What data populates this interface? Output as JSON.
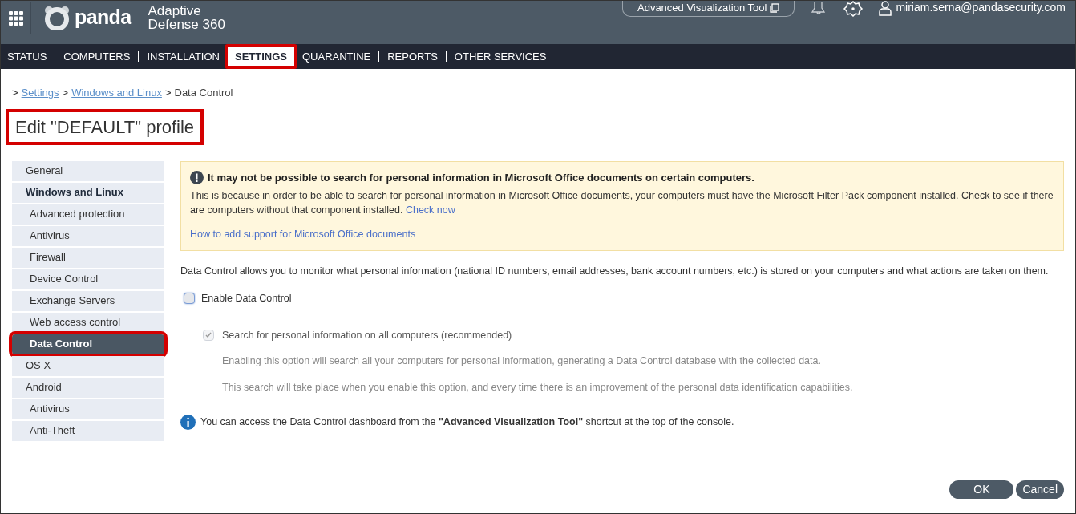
{
  "header": {
    "logo": "panda",
    "product": [
      "Adaptive",
      "Defense 360"
    ],
    "tool_button": "Advanced Visualization Tool",
    "user": "miriam.serna@pandasecurity.com"
  },
  "nav": [
    {
      "label": "STATUS",
      "selected": false,
      "highlighted": false
    },
    {
      "label": "COMPUTERS",
      "selected": false,
      "highlighted": false
    },
    {
      "label": "INSTALLATION",
      "selected": false,
      "highlighted": false
    },
    {
      "label": "SETTINGS",
      "selected": true,
      "highlighted": true
    },
    {
      "label": "QUARANTINE",
      "selected": false,
      "highlighted": false
    },
    {
      "label": "REPORTS",
      "selected": false,
      "highlighted": false
    },
    {
      "label": "OTHER SERVICES",
      "selected": false,
      "highlighted": false
    }
  ],
  "breadcrumb": [
    {
      "separator": ">",
      "label": "Settings",
      "link": true
    },
    {
      "separator": ">",
      "label": "Windows and Linux",
      "link": true
    },
    {
      "separator": ">",
      "label": "Data Control",
      "link": false
    }
  ],
  "page_title": {
    "text": "Edit \"DEFAULT\" profile",
    "highlighted": true
  },
  "sidebar": [
    {
      "label": "General",
      "selected": false,
      "highlighted": false
    },
    {
      "label": "Windows and Linux",
      "selected": true,
      "highlighted": false,
      "children": [
        {
          "label": "Advanced protection",
          "selected": false,
          "highlighted": false
        },
        {
          "label": "Antivirus",
          "selected": false,
          "highlighted": false
        },
        {
          "label": "Firewall",
          "selected": false,
          "highlighted": false
        },
        {
          "label": "Device Control",
          "selected": false,
          "highlighted": false
        },
        {
          "label": "Exchange Servers",
          "selected": false,
          "highlighted": false
        },
        {
          "label": "Web access control",
          "selected": false,
          "highlighted": false
        },
        {
          "label": "Data Control",
          "selected": true,
          "highlighted": true
        }
      ]
    },
    {
      "label": "OS X",
      "selected": false,
      "highlighted": false
    },
    {
      "label": "Android",
      "selected": false,
      "highlighted": false,
      "children": [
        {
          "label": "Antivirus",
          "selected": false,
          "highlighted": false
        },
        {
          "label": "Anti-Theft",
          "selected": false,
          "highlighted": false
        }
      ]
    }
  ],
  "warning": {
    "title": "It may not be possible to search for personal information in Microsoft Office documents on certain computers.",
    "text": "This is because in order to be able to search for personal information in Microsoft Office documents, your computers must have the Microsoft Filter Pack component installed. Check to see if there are computers without that component installed.",
    "check_link": "Check now",
    "support_link": "How to add support for Microsoft Office documents"
  },
  "description": "Data Control allows you to monitor what personal information (national ID numbers, email addresses, bank account numbers, etc.) is stored on your computers and what actions are taken on them.",
  "enable_option": {
    "label": "Enable Data Control",
    "checked": false,
    "disabled": false
  },
  "search_option": {
    "label": "Search for personal information on all computers (recommended)",
    "checked": true,
    "disabled": true,
    "notes": [
      "Enabling this option will search all your computers for personal information, generating a Data Control database with the collected data.",
      "This search will take place when you enable this option, and every time there is an improvement of the personal data identification capabilities."
    ]
  },
  "info": "You can access the Data Control dashboard from the **\"Advanced Visualization Tool\"** shortcut at the top of the console.",
  "buttons": [
    "OK",
    "Cancel"
  ]
}
